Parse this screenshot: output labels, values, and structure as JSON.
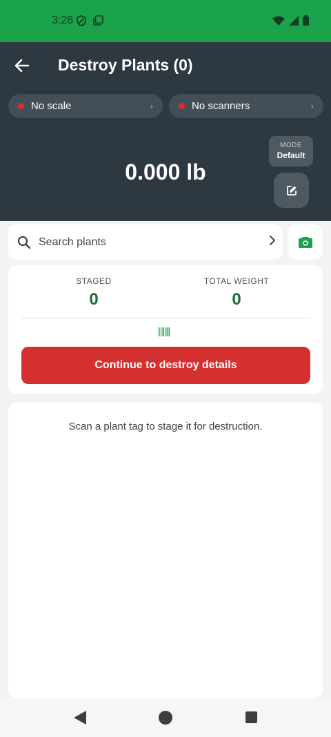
{
  "status_bar": {
    "time": "3:28",
    "icons": [
      "shield-icon",
      "clipboard-icon",
      "wifi-icon",
      "signal-icon",
      "battery-icon"
    ]
  },
  "header": {
    "title": "Destroy Plants (0)",
    "scale_status": "No scale",
    "scanner_status": "No scanners",
    "weight_display": "0.000 lb",
    "mode_label": "MODE",
    "mode_value": "Default"
  },
  "search": {
    "placeholder": "Search plants"
  },
  "stats": {
    "staged_label": "STAGED",
    "staged_value": "0",
    "total_weight_label": "TOTAL WEIGHT",
    "total_weight_value": "0"
  },
  "actions": {
    "continue_label": "Continue to destroy details"
  },
  "list": {
    "empty_message": "Scan a plant tag to stage it for destruction."
  },
  "colors": {
    "status_bar": "#1aa34a",
    "header_bg": "#2d3841",
    "accent_green": "#1b6b36",
    "danger": "#d4302f",
    "status_dot": "#e02b2b"
  }
}
